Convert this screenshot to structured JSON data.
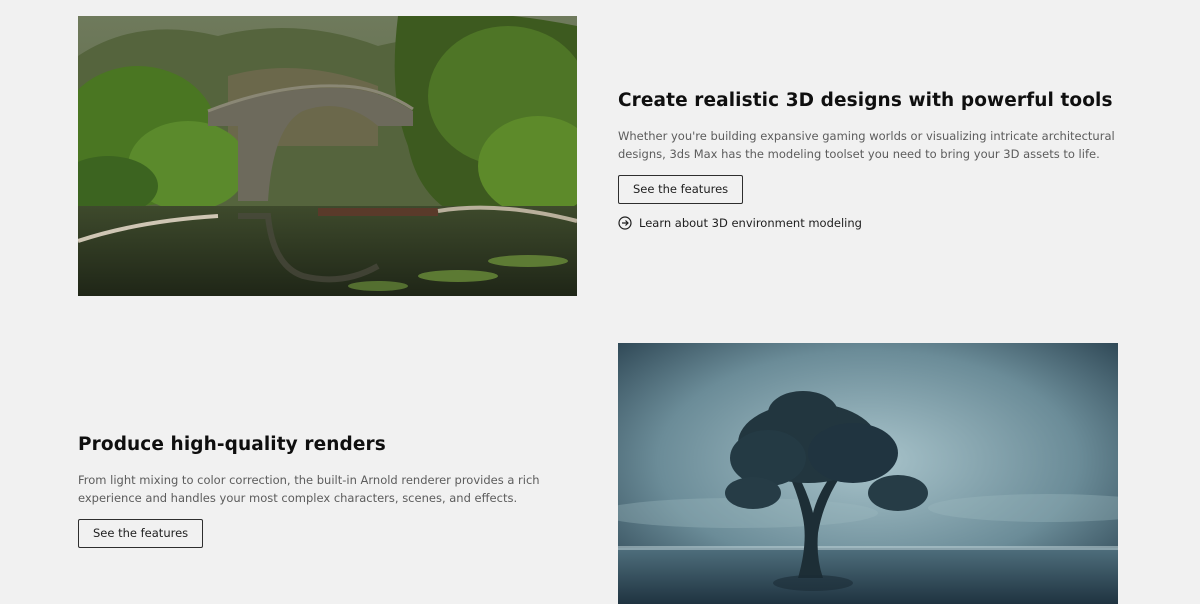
{
  "section1": {
    "heading": "Create realistic 3D designs with powerful tools",
    "body": "Whether you're building expansive gaming worlds or visualizing intricate architectural designs, 3ds Max has the modeling toolset you need to bring your 3D assets to life.",
    "button_label": "See the features",
    "link_label": "Learn about 3D environment modeling",
    "link_icon": "arrow-circle-right-icon",
    "image": "stone-arch-bridge-over-lake-photo"
  },
  "section2": {
    "heading": "Produce high-quality renders",
    "body": "From light mixing to color correction, the built-in Arnold renderer provides a rich experience and handles your most complex characters, scenes, and effects.",
    "button_label": "See the features",
    "image": "lone-tree-in-misty-water-photo"
  },
  "colors": {
    "background": "#f1f1f1",
    "heading": "#0f0f0f",
    "body": "#5c5c5c",
    "button_border": "#2e2e2e"
  }
}
